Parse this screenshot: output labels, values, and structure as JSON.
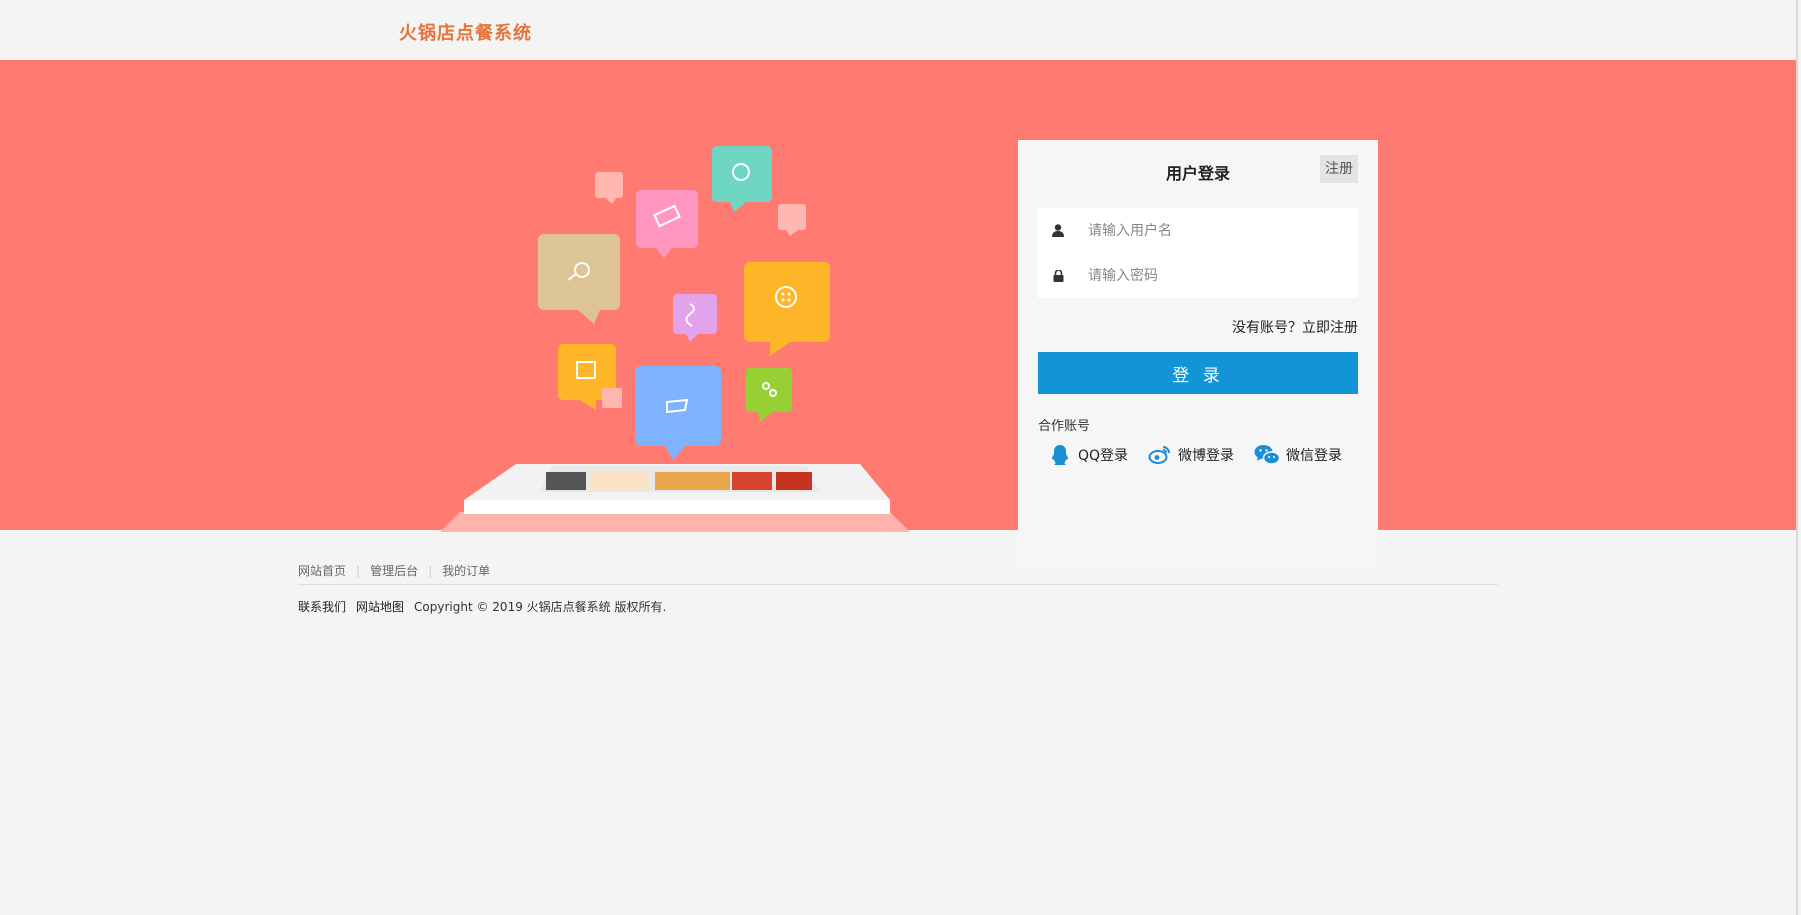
{
  "header": {
    "title": "火锅店点餐系统"
  },
  "login": {
    "title": "用户登录",
    "register_tab": "注册",
    "username_placeholder": "请输入用户名",
    "password_placeholder": "请输入密码",
    "no_account_link": "没有账号？立即注册",
    "login_button": "登 录",
    "partner_label": "合作账号",
    "social": [
      {
        "label": "QQ登录",
        "icon": "qq-icon"
      },
      {
        "label": "微博登录",
        "icon": "weibo-icon"
      },
      {
        "label": "微信登录",
        "icon": "wechat-icon"
      }
    ]
  },
  "footer": {
    "links": [
      "网站首页",
      "管理后台",
      "我的订单"
    ],
    "contact": "联系我们",
    "sitemap": "网站地图",
    "copyright": "Copyright © 2019 火锅店点餐系统 版权所有."
  },
  "colors": {
    "banner": "#ff7a70",
    "accent": "#e5733d",
    "button": "#1394d6"
  }
}
